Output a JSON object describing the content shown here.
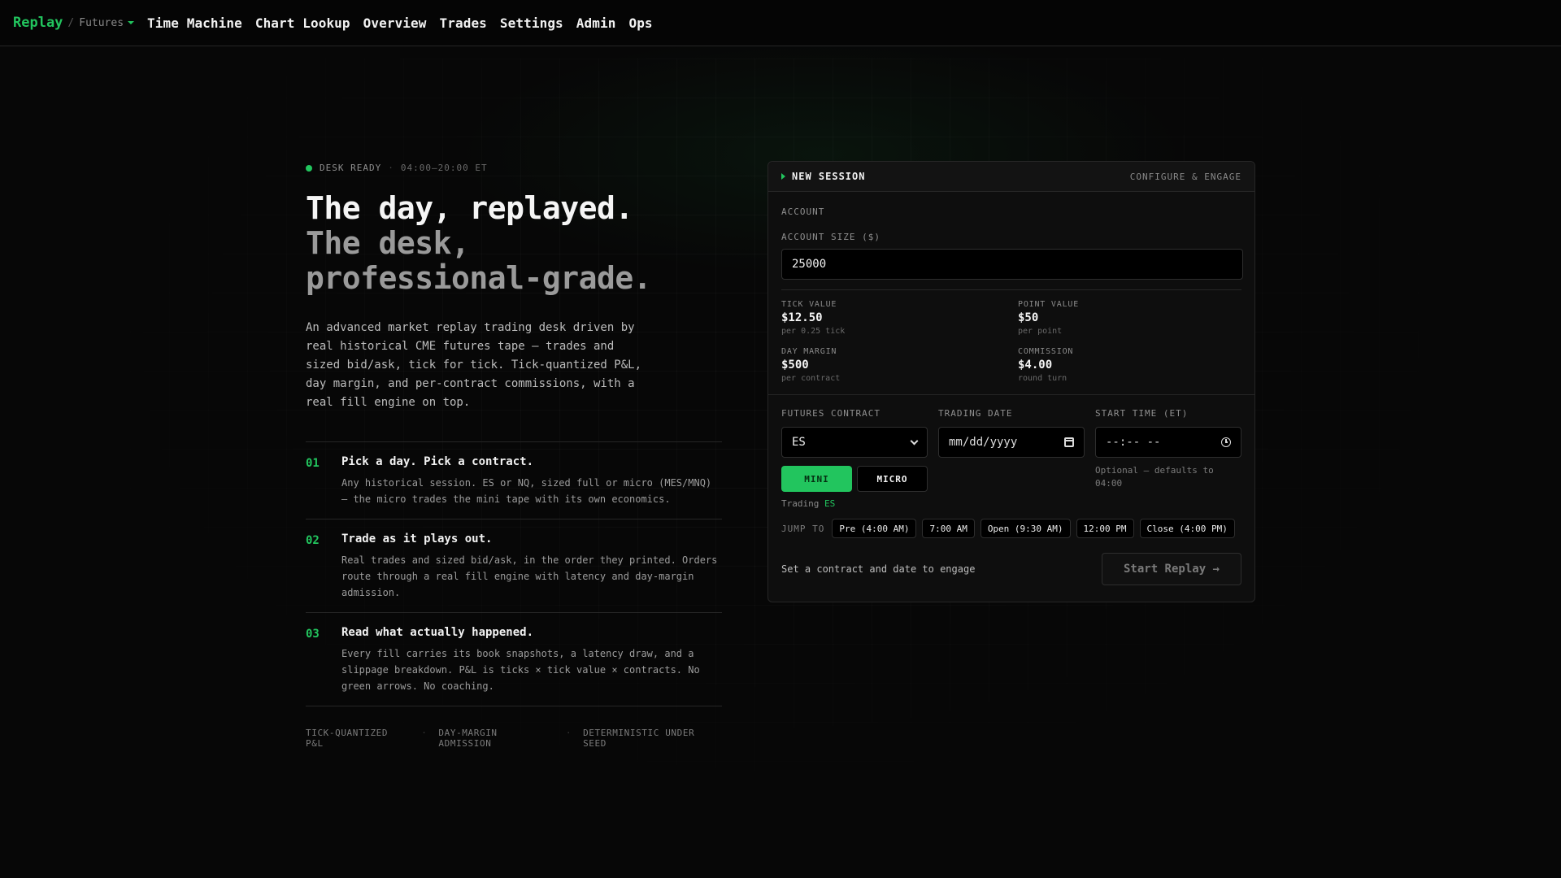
{
  "nav": {
    "brand": "Replay",
    "slash": "/",
    "workspace": "Futures",
    "links": [
      "Time Machine",
      "Chart Lookup",
      "Overview",
      "Trades",
      "Settings",
      "Admin",
      "Ops"
    ]
  },
  "hero": {
    "status_label": "DESK READY",
    "status_sep": "·",
    "hours": "04:00–20:00 ET",
    "headline_line1": "The day, replayed.",
    "headline_line2": "The desk,",
    "headline_line3": "professional-grade.",
    "intro": "An advanced market replay trading desk driven by real historical CME futures tape — trades and sized bid/ask, tick for tick. Tick-quantized P&L, day margin, and per-contract commissions, with a real fill engine on top."
  },
  "features": [
    {
      "num": "01",
      "title": "Pick a day. Pick a contract.",
      "desc": "Any historical session. ES or NQ, sized full or micro (MES/MNQ) — the micro trades the mini tape with its own economics."
    },
    {
      "num": "02",
      "title": "Trade as it plays out.",
      "desc": "Real trades and sized bid/ask, in the order they printed. Orders route through a real fill engine with latency and day-margin admission."
    },
    {
      "num": "03",
      "title": "Read what actually happened.",
      "desc": "Every fill carries its book snapshots, a latency draw, and a slippage breakdown. P&L is ticks × tick value × contracts. No green arrows. No coaching."
    }
  ],
  "tags": [
    "TICK-QUANTIZED P&L",
    "DAY-MARGIN ADMISSION",
    "DETERMINISTIC UNDER SEED"
  ],
  "tag_sep": "·",
  "panel": {
    "title": "NEW SESSION",
    "action": "CONFIGURE & ENGAGE",
    "account_section": "ACCOUNT",
    "account_size_label": "ACCOUNT SIZE ($)",
    "account_size_value": "25000",
    "specs": [
      {
        "label": "TICK VALUE",
        "value": "$12.50",
        "sub": "per 0.25 tick"
      },
      {
        "label": "POINT VALUE",
        "value": "$50",
        "sub": "per point"
      },
      {
        "label": "DAY MARGIN",
        "value": "$500",
        "sub": "per contract"
      },
      {
        "label": "COMMISSION",
        "value": "$4.00",
        "sub": "round turn"
      }
    ],
    "contract_label": "FUTURES CONTRACT",
    "contract_value": "ES",
    "date_label": "TRADING DATE",
    "date_placeholder": "mm/dd/yyyy",
    "time_label": "START TIME (ET)",
    "time_placeholder": "--:-- --",
    "toggle_mini": "MINI",
    "toggle_micro": "MICRO",
    "trading_prefix": "Trading",
    "trading_symbol": "ES",
    "time_hint": "Optional — defaults to 04:00",
    "jump_label": "JUMP TO",
    "jump_options": [
      "Pre (4:00 AM)",
      "7:00 AM",
      "Open (9:30 AM)",
      "12:00 PM",
      "Close (4:00 PM)"
    ],
    "footer_msg": "Set a contract and date to engage",
    "start_label": "Start Replay →"
  },
  "colors": {
    "accent": "#22c55e",
    "background": "#070707",
    "panel": "#0e0e0e"
  }
}
